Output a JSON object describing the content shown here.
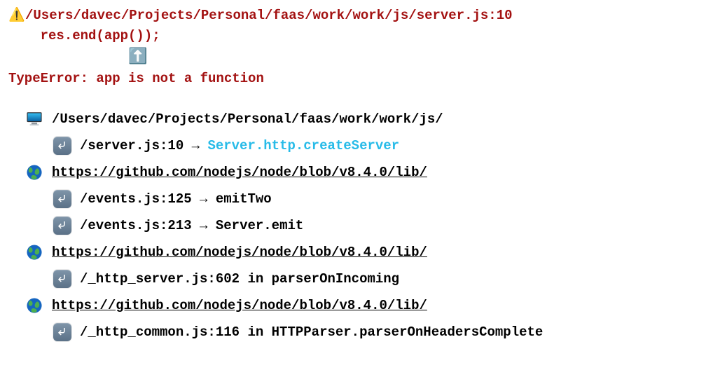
{
  "error": {
    "location": "/Users/davec/Projects/Personal/faas/work/work/js/server.js:10",
    "code_indent": "    ",
    "code": "res.end(app());",
    "pointer_indent": "               ",
    "message": "TypeError: app is not a function"
  },
  "stack": [
    {
      "icon": "monitor",
      "head": "/Users/davec/Projects/Personal/faas/work/work/js/",
      "underline": false,
      "items": [
        {
          "file": "/server.js:10",
          "sep": " → ",
          "symbol": "Server.http.createServer",
          "symbol_link": true
        }
      ]
    },
    {
      "icon": "globe",
      "head": "https://github.com/nodejs/node/blob/v8.4.0/lib/",
      "underline": true,
      "items": [
        {
          "file": "/events.js:125",
          "sep": " → ",
          "symbol": "emitTwo",
          "symbol_link": false
        },
        {
          "file": "/events.js:213",
          "sep": " → ",
          "symbol": "Server.emit",
          "symbol_link": false
        }
      ]
    },
    {
      "icon": "globe",
      "head": "https://github.com/nodejs/node/blob/v8.4.0/lib/",
      "underline": true,
      "items": [
        {
          "file": "/_http_server.js:602",
          "sep": " in ",
          "symbol": "parserOnIncoming",
          "symbol_link": false
        }
      ]
    },
    {
      "icon": "globe",
      "head": "https://github.com/nodejs/node/blob/v8.4.0/lib/",
      "underline": true,
      "items": [
        {
          "file": "/_http_common.js:116",
          "sep": " in ",
          "symbol": "HTTPParser.parserOnHeadersComplete",
          "symbol_link": false
        }
      ]
    }
  ]
}
